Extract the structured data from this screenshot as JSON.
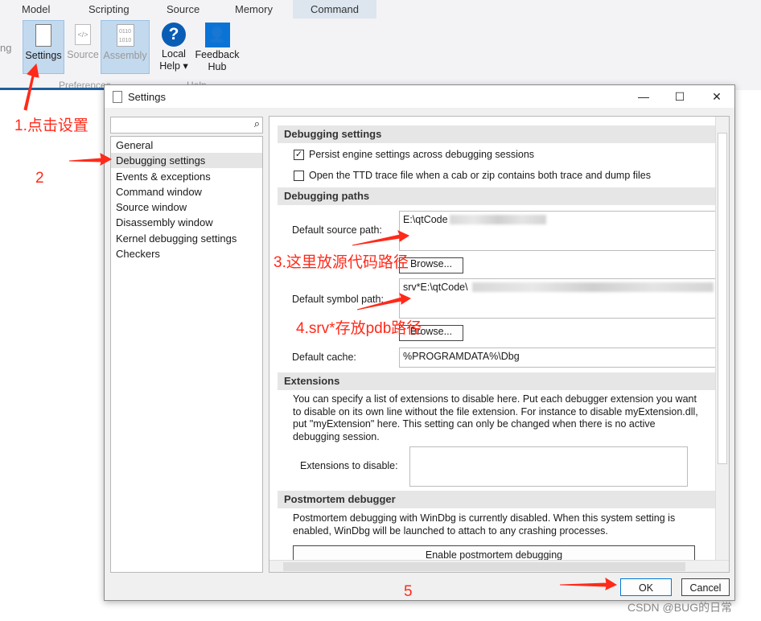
{
  "ribbon": {
    "tabs": [
      "Model",
      "Scripting",
      "Source",
      "Memory",
      "Command"
    ],
    "active_tab": "Command",
    "partial_left": "ng",
    "buttons": [
      {
        "label": "Settings",
        "icon": "settings-doc-icon"
      },
      {
        "label": "Source",
        "icon": "source-code-icon"
      },
      {
        "label": "Assembly",
        "icon": "assembly-binary-icon"
      },
      {
        "label": "Local Help ▾",
        "icon": "help-icon"
      },
      {
        "label": "Feedback Hub",
        "icon": "feedback-hub-icon"
      }
    ],
    "groups": [
      "Preferences",
      "Help"
    ]
  },
  "dialog": {
    "title": "Settings",
    "minimize": "—",
    "maximize": "☐",
    "close": "✕",
    "search": {
      "value": "",
      "placeholder": ""
    },
    "nav": [
      "General",
      "Debugging settings",
      "Events & exceptions",
      "Command window",
      "Source window",
      "Disassembly window",
      "Kernel debugging settings",
      "Checkers"
    ],
    "selected_nav": "Debugging settings",
    "sections": {
      "debugging_settings": "Debugging settings",
      "debugging_paths": "Debugging paths",
      "extensions": "Extensions",
      "postmortem": "Postmortem debugger"
    },
    "checkboxes": [
      {
        "label": "Persist engine settings across debugging sessions",
        "checked": true
      },
      {
        "label": "Open the TTD trace file when a cab or zip contains both trace and dump files",
        "checked": false
      }
    ],
    "source_path": {
      "label": "Default source path:",
      "value": "E:\\qtCode"
    },
    "symbol_path": {
      "label": "Default symbol path:",
      "value": "srv*E:\\qtCode\\"
    },
    "browse": "Browse...",
    "cache": {
      "label": "Default cache:",
      "value": "%PROGRAMDATA%\\Dbg"
    },
    "extensions_text": "You can specify a list of extensions to disable here. Put each debugger extension you want to disable on its own line without the file extension. For instance to disable myExtension.dll, put \"myExtension\" here. This setting can only be changed when there is no active debugging session.",
    "extensions_label": "Extensions to disable:",
    "postmortem_text": "Postmortem debugging with WinDbg is currently disabled. When this system setting is enabled, WinDbg will be launched to attach to any crashing processes.",
    "postmortem_button": "Enable postmortem debugging",
    "ok": "OK",
    "cancel": "Cancel"
  },
  "annotations": {
    "a1": "1.点击设置",
    "a2": "2",
    "a3": "3.这里放源代码路径",
    "a4": "4.srv*存放pdb路径",
    "a5": "5",
    "color": "#ff2a1a"
  },
  "watermark": "CSDN @BUG的日常"
}
